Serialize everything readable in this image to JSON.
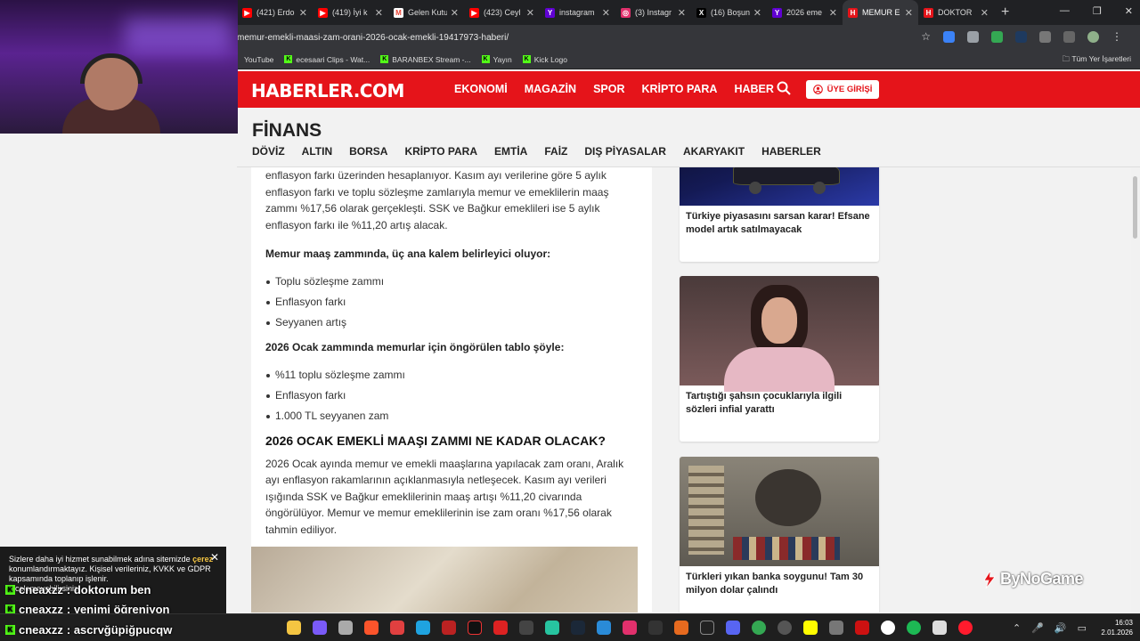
{
  "browser": {
    "tabs": [
      {
        "title": "(421) Erdo",
        "color": "#ff0000"
      },
      {
        "title": "(419) İyi k",
        "color": "#ff0000"
      },
      {
        "title": "Gelen Kutu",
        "color": "#ea4335"
      },
      {
        "title": "(423) Ceyl",
        "color": "#ff0000"
      },
      {
        "title": "instagram",
        "color": "#6001d2"
      },
      {
        "title": "(3) Instagr",
        "color": "#e1306c"
      },
      {
        "title": "(16) Boşun",
        "color": "#000000"
      },
      {
        "title": "2026 eme",
        "color": "#6001d2"
      },
      {
        "title": "MEMUR E",
        "color": "#e5141a"
      },
      {
        "title": "DOKTOR",
        "color": "#e5141a"
      }
    ],
    "url": "memur-emekli-maasi-zam-orani-2026-ocak-emekli-19417973-haberi/",
    "bookmarks": [
      "YouTube",
      "ecesaari Clips - Wat...",
      "BARANBEX Stream -...",
      "Yayın",
      "Kick Logo"
    ],
    "all_bookmarks": "Tüm Yer İşaretleri"
  },
  "site": {
    "logo": "HABERLER.COM",
    "nav": [
      "EKONOMİ",
      "MAGAZİN",
      "SPOR",
      "KRİPTO PARA",
      "HABER"
    ],
    "login": "ÜYE GİRİŞİ",
    "section_title": "FİNANS",
    "subnav": [
      "DÖVİZ",
      "ALTIN",
      "BORSA",
      "KRİPTO PARA",
      "EMTİA",
      "FAİZ",
      "DIŞ PİYASALAR",
      "AKARYAKIT",
      "HABERLER"
    ]
  },
  "article": {
    "p1": "enflasyon farkı üzerinden hesaplanıyor. Kasım ayı verilerine göre 5 aylık enflasyon farkı ve toplu sözleşme zamlarıyla memur ve emeklilerin maaş zammı %17,56 olarak gerçekleşti. SSK ve Bağkur emeklileri ise 5 aylık enflasyon farkı ile %11,20 artış alacak.",
    "heading1": "Memur maaş zammında, üç ana kalem belirleyici oluyor:",
    "list1": [
      "Toplu sözleşme zammı",
      "Enflasyon farkı",
      "Seyyanen artış"
    ],
    "heading2": "2026 Ocak zammında memurlar için öngörülen tablo şöyle:",
    "list2": [
      "%11 toplu sözleşme zammı",
      "Enflasyon farkı",
      "1.000 TL seyyanen zam"
    ],
    "h2": "2026 OCAK EMEKLİ MAAŞI ZAMMI NE KADAR OLACAK?",
    "p2": "2026 Ocak ayında memur ve emekli maaşlarına yapılacak zam oranı, Aralık ayı enflasyon rakamlarının açıklanmasıyla netleşecek. Kasım ayı verileri ışığında SSK ve Bağkur emeklilerinin maaş artışı %11,20 civarında öngörülüyor. Memur ve memur emeklilerinin ise zam oranı %17,56 olarak tahmin ediliyor."
  },
  "sidebar": {
    "cards": [
      {
        "caption": "Türkiye piyasasını sarsan karar! Efsane model artık satılmayacak"
      },
      {
        "caption": "Tartıştığı şahsın çocuklarıyla ilgili sözleri infial yarattı"
      },
      {
        "caption": "Türkleri yıkan banka soygunu! Tam 30 milyon dolar çalındı"
      }
    ]
  },
  "overlay": {
    "brand": "ByNoGame",
    "cookie_text_1": "Sizlere daha iyi hizmet sunabilmek adına sitemizde",
    "cookie_highlight": "çerez",
    "cookie_text_2": "konumlandırmaktayız. Kişisel verileriniz, KVKK ve GDPR kapsamında toplanıp işlenir.",
    "cookie_text_3": "incelemeyebilirsiniz.",
    "chat": [
      {
        "user": "cneaxzz",
        "msg": ": doktorum ben"
      },
      {
        "user": "cneaxzz",
        "msg": ": yenimi öğreniyon"
      },
      {
        "user": "cneaxzz",
        "msg": ": ascrvğüpiğpucqw"
      }
    ]
  },
  "taskbar": {
    "time": "16:03",
    "date": "2.01.2026"
  }
}
